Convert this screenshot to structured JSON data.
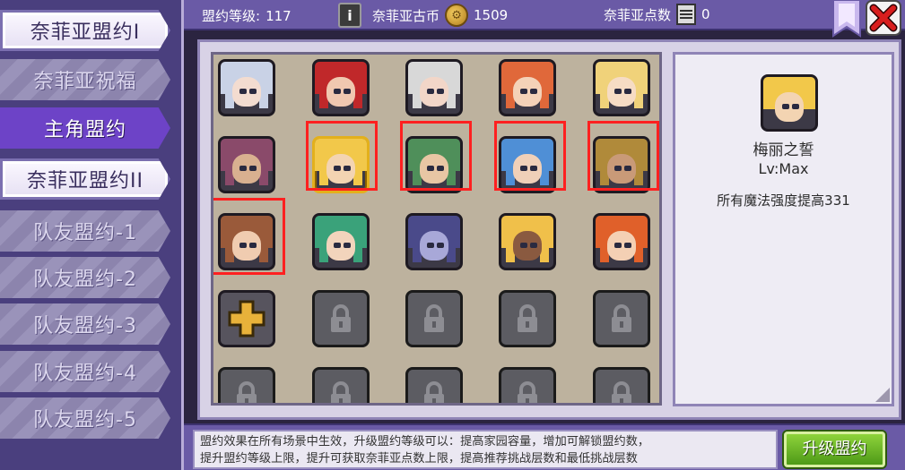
{
  "sidebar": {
    "tabs": [
      {
        "label": "奈菲亚盟约I",
        "state": "active-white"
      },
      {
        "label": "奈菲亚祝福",
        "state": "inactive"
      },
      {
        "label": "主角盟约",
        "state": "selected"
      },
      {
        "label": "奈菲亚盟约II",
        "state": "active-white"
      },
      {
        "label": "队友盟约-1",
        "state": "inactive"
      },
      {
        "label": "队友盟约-2",
        "state": "inactive"
      },
      {
        "label": "队友盟约-3",
        "state": "inactive"
      },
      {
        "label": "队友盟约-4",
        "state": "inactive"
      },
      {
        "label": "队友盟约-5",
        "state": "inactive"
      }
    ]
  },
  "topbar": {
    "level_label": "盟约等级:",
    "level_value": "117",
    "coin_label": "奈菲亚古币",
    "coin_value": "1509",
    "points_label": "奈菲亚点数",
    "points_value": "0",
    "info_icon": "info-icon",
    "coin_icon": "coin-icon",
    "points_icon": "points-card-icon",
    "close_icon": "close-icon"
  },
  "grid": {
    "slots": [
      {
        "type": "portrait",
        "hair": "#c9d2e6",
        "skin": "#f3dcd0"
      },
      {
        "type": "portrait",
        "hair": "#c0282a",
        "skin": "#f0c8b0"
      },
      {
        "type": "portrait",
        "hair": "#d8d8d8",
        "skin": "#f2d6c8"
      },
      {
        "type": "portrait",
        "hair": "#e0683a",
        "skin": "#f4d2b8"
      },
      {
        "type": "portrait",
        "hair": "#f0d27a",
        "skin": "#f6dcc4"
      },
      {
        "type": "portrait",
        "hair": "#8a4a6a",
        "skin": "#d9b090"
      },
      {
        "type": "portrait",
        "hair": "#f2c84a",
        "skin": "#f3d4b2",
        "gold": true
      },
      {
        "type": "portrait",
        "hair": "#4f8f5a",
        "skin": "#e8c6a4"
      },
      {
        "type": "portrait",
        "hair": "#4f8fd6",
        "skin": "#f0d0b8"
      },
      {
        "type": "portrait",
        "hair": "#b08a3a",
        "skin": "#c99a78"
      },
      {
        "type": "portrait",
        "hair": "#9a5a3a",
        "skin": "#f0ccb0"
      },
      {
        "type": "portrait",
        "hair": "#3aa27a",
        "skin": "#f2d4bc"
      },
      {
        "type": "portrait",
        "hair": "#4a4a8a",
        "skin": "#a8a8d8"
      },
      {
        "type": "portrait",
        "hair": "#f0c04a",
        "skin": "#8a5a40"
      },
      {
        "type": "portrait",
        "hair": "#e0602a",
        "skin": "#f4d0b4"
      },
      {
        "type": "add"
      },
      {
        "type": "locked"
      },
      {
        "type": "locked"
      },
      {
        "type": "locked"
      },
      {
        "type": "locked"
      },
      {
        "type": "locked"
      },
      {
        "type": "locked"
      },
      {
        "type": "locked"
      },
      {
        "type": "locked"
      },
      {
        "type": "locked"
      }
    ]
  },
  "detail": {
    "name": "梅丽之誓",
    "level": "Lv:Max",
    "effect": "所有魔法强度提高331",
    "portrait_hair": "#f2c84a",
    "portrait_skin": "#f3d4b2"
  },
  "bottom": {
    "line1": "盟约效果在所有场景中生效，升级盟约等级可以：提高家园容量，增加可解锁盟约数，",
    "line2": "提升盟约等级上限，提升可获取奈菲亚点数上限，提高推荐挑战层数和最低挑战层数",
    "upgrade_label": "升级盟约"
  },
  "colors": {
    "highlight": "#ff2020",
    "upgrade_button": "#6cb82a",
    "selected_tab": "#6d43c7"
  }
}
